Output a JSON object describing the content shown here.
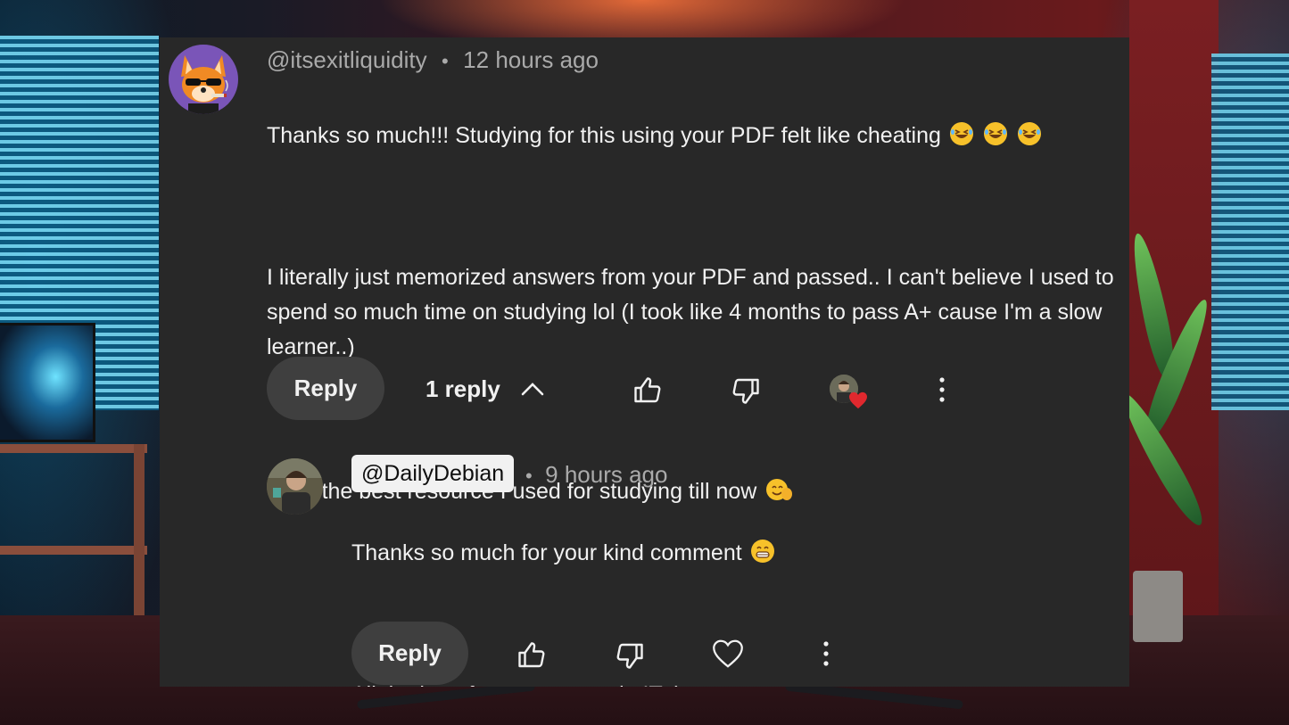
{
  "comment": {
    "author": "@itsexitliquidity",
    "time": "12 hours ago",
    "paragraphs": [
      "Thanks so much!!! Studying for this using your PDF felt like cheating",
      "I literally just memorized answers from your PDF and passed.. I can't believe I used to spend so much time on studying lol (I took like 4 months to pass A+ cause I'm a slow learner..)",
      "Truly the best resource I used for studying till now"
    ],
    "reply_label": "Reply",
    "replies_count_label": "1 reply"
  },
  "reply": {
    "author": "@DailyDebian",
    "time": "9 hours ago",
    "paragraphs": [
      "Thanks so much for your kind comment",
      "All the best for your career in IT :)"
    ],
    "reply_label": "Reply"
  },
  "separator": "•",
  "icons": {
    "like": "thumbs-up-icon",
    "dislike": "thumbs-down-icon",
    "heart": "heart-icon",
    "more": "more-vertical-icon",
    "collapse": "chevron-up-icon"
  },
  "colors": {
    "panel_bg": "#282828",
    "text": "#f1f1f1",
    "secondary_text": "#aaaaaa",
    "button_bg": "#3f3f3f",
    "heart_badge": "#e0282e",
    "avatar_purple": "#7a55b8"
  }
}
